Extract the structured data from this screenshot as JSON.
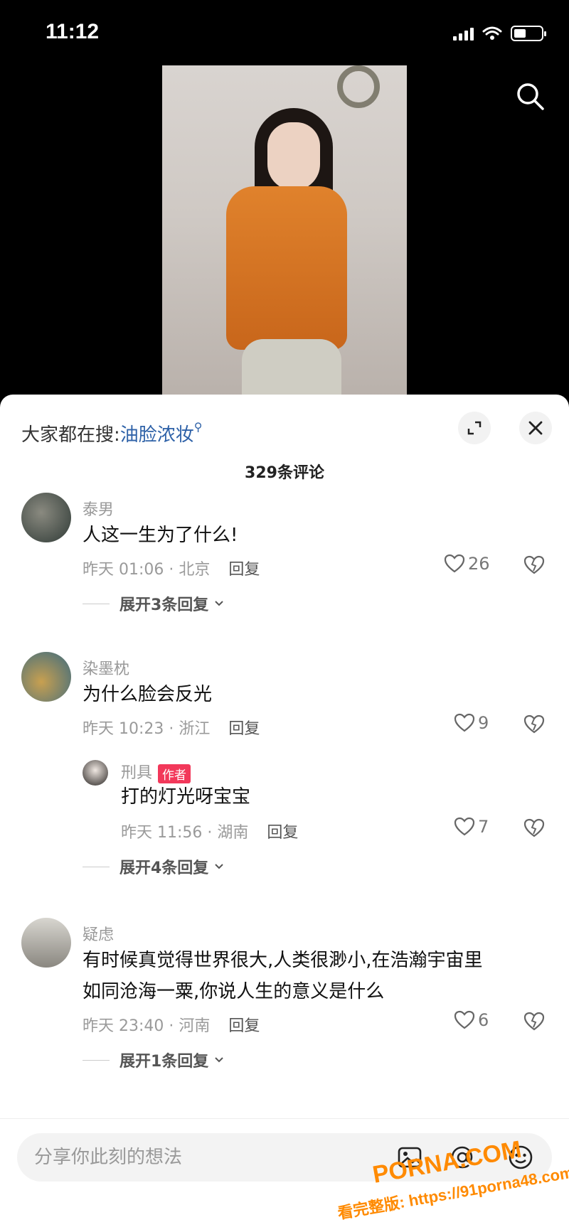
{
  "status_bar": {
    "time": "11:12"
  },
  "trending": {
    "label": "大家都在搜:",
    "term": "油脸浓妆"
  },
  "comments_header": {
    "count_title": "329条评论"
  },
  "comments": [
    {
      "username": "泰男",
      "text": "人这一生为了什么!",
      "time_location": "昨天 01:06 · 北京",
      "reply_label": "回复",
      "likes": "26",
      "expand_label": "展开3条回复"
    },
    {
      "username": "染墨枕",
      "text": "为什么脸会反光",
      "time_location": "昨天 10:23 · 浙江",
      "reply_label": "回复",
      "likes": "9",
      "sub_reply": {
        "username": "刑具",
        "badge": "作者",
        "text": "打的灯光呀宝宝",
        "time_location": "昨天 11:56 · 湖南",
        "reply_label": "回复",
        "likes": "7"
      },
      "expand_label": "展开4条回复"
    },
    {
      "username": "疑虑",
      "text_line1": "有时候真觉得世界很大,人类很渺小,在浩瀚宇宙里",
      "text_line2": "如同沧海一粟,你说人生的意义是什么",
      "time_location": "昨天 23:40 · 河南",
      "reply_label": "回复",
      "likes": "6",
      "expand_label": "展开1条回复"
    }
  ],
  "input": {
    "placeholder": "分享你此刻的想法"
  },
  "watermark": {
    "main": "PORNA.COM",
    "url": "看完整版: https://91porna48.com"
  },
  "colors": {
    "accent_link": "#2f62a8",
    "author_badge": "#f2385a",
    "watermark": "#ff8a00"
  },
  "icons": [
    "search-icon",
    "expand-icon",
    "close-icon",
    "heart-icon",
    "broken-heart-icon",
    "chevron-down-icon",
    "image-icon",
    "at-icon",
    "emoji-icon"
  ]
}
